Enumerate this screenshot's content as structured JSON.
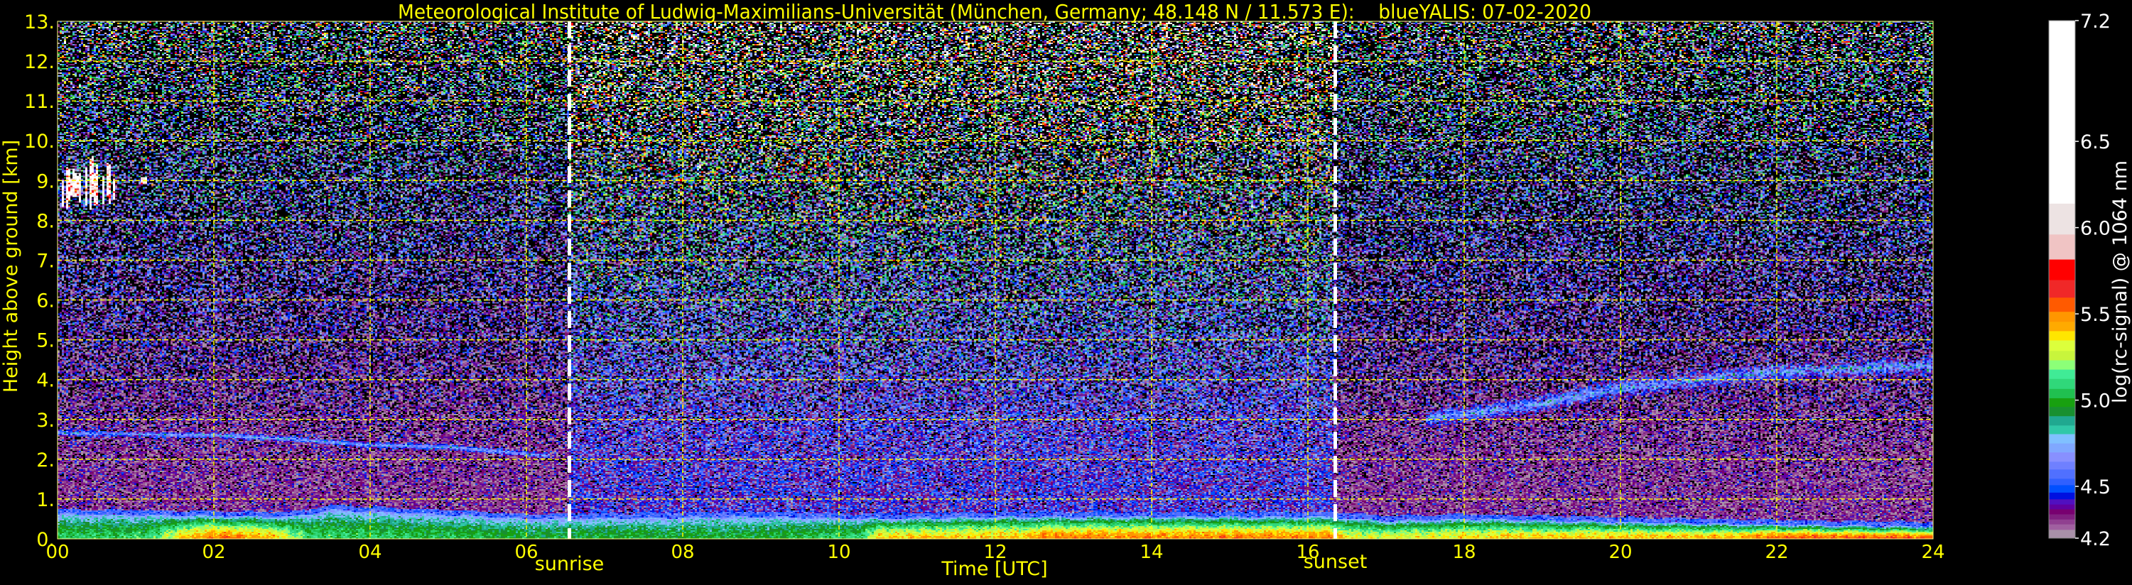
{
  "chart_data": {
    "type": "heatmap",
    "title": "Meteorological Institute of Ludwig-Maximilians-Universität (München, Germany; 48.148 N / 11.573 E):    blueYALIS: 07-02-2020",
    "xlabel": "Time [UTC]",
    "ylabel": "Height above ground [km]",
    "xlim": [
      0,
      24
    ],
    "ylim": [
      0,
      13
    ],
    "grid": true,
    "xticks": [
      {
        "value": 0,
        "label": "00"
      },
      {
        "value": 2,
        "label": "02"
      },
      {
        "value": 4,
        "label": "04"
      },
      {
        "value": 6,
        "label": "06"
      },
      {
        "value": 8,
        "label": "08"
      },
      {
        "value": 10,
        "label": "10"
      },
      {
        "value": 12,
        "label": "12"
      },
      {
        "value": 14,
        "label": "14"
      },
      {
        "value": 16,
        "label": "16"
      },
      {
        "value": 18,
        "label": "18"
      },
      {
        "value": 20,
        "label": "20"
      },
      {
        "value": 22,
        "label": "22"
      },
      {
        "value": 24,
        "label": "24"
      }
    ],
    "yticks": [
      {
        "value": 0,
        "label": "0."
      },
      {
        "value": 1,
        "label": "1."
      },
      {
        "value": 2,
        "label": "2."
      },
      {
        "value": 3,
        "label": "3."
      },
      {
        "value": 4,
        "label": "4."
      },
      {
        "value": 5,
        "label": "5."
      },
      {
        "value": 6,
        "label": "6."
      },
      {
        "value": 7,
        "label": "7."
      },
      {
        "value": 8,
        "label": "8."
      },
      {
        "value": 9,
        "label": "9."
      },
      {
        "value": 10,
        "label": "10."
      },
      {
        "value": 11,
        "label": "11."
      },
      {
        "value": 12,
        "label": "12."
      },
      {
        "value": 13,
        "label": "13."
      }
    ],
    "annotations": [
      {
        "label": "sunrise",
        "time": 6.55
      },
      {
        "label": "sunset",
        "time": 16.35
      }
    ],
    "colorbar": {
      "label": "log(rc-signal) @ 1064 nm",
      "range": [
        4.2,
        7.2
      ],
      "ticks": [
        {
          "value": 7.2,
          "label": "7.2"
        },
        {
          "value": 6.5,
          "label": "6.5"
        },
        {
          "value": 6.0,
          "label": "6.0"
        },
        {
          "value": 5.5,
          "label": "5.5"
        },
        {
          "value": 5.0,
          "label": "5.0"
        },
        {
          "value": 4.5,
          "label": "4.5"
        },
        {
          "value": 4.2,
          "label": "4.2"
        }
      ],
      "levels": [
        4.2,
        4.25,
        4.282,
        4.31,
        4.34,
        4.369,
        4.397,
        4.427,
        4.466,
        4.509,
        4.546,
        4.6,
        4.645,
        4.699,
        4.751,
        4.805,
        4.855,
        4.909,
        4.963,
        5.013,
        5.067,
        5.125,
        5.179,
        5.233,
        5.287,
        5.348,
        5.402,
        5.456,
        5.514,
        5.596,
        5.698,
        5.817,
        5.962,
        6.141,
        7.2
      ],
      "colors": [
        "#a890a8",
        "#a060a0",
        "#904090",
        "#802080",
        "#780070",
        "#6000a0",
        "#5010c0",
        "#0010e0",
        "#0050ff",
        "#3060ff",
        "#5070ff",
        "#6f80ff",
        "#8890ff",
        "#80a8ff",
        "#80c0ff",
        "#30c8a8",
        "#20a890",
        "#189030",
        "#18a010",
        "#20c050",
        "#30d87a",
        "#40eb96",
        "#8cff78",
        "#c8f53c",
        "#dcff3c",
        "#ffe600",
        "#ffaa00",
        "#ff9600",
        "#ff5a00",
        "#f02828",
        "#ff0000",
        "#f0c4c4",
        "#ede3e3",
        "#ffffff"
      ],
      "below_range_color": "#000000"
    },
    "text_color": "#ffff00",
    "grid_color": "#ffff00",
    "sun_line_color": "#ffffff"
  }
}
